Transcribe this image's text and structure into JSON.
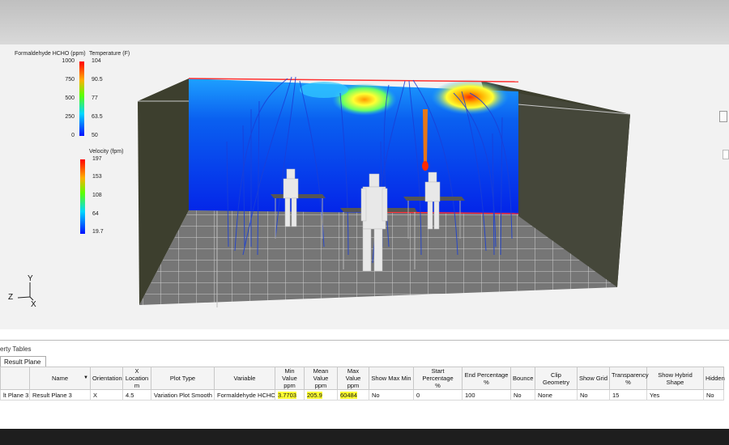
{
  "legends": {
    "hcho": {
      "title": "Formaldehyde HCHO (ppm)",
      "ticks": [
        "1000",
        "750",
        "500",
        "250",
        "0"
      ]
    },
    "temperature": {
      "title": "Temperature (F)",
      "ticks": [
        "104",
        "90.5",
        "77",
        "63.5",
        "50"
      ]
    },
    "velocity": {
      "title": "Velocity (fpm)",
      "ticks": [
        "197",
        "153",
        "108",
        "64",
        "19.7"
      ]
    }
  },
  "axes": {
    "y": "Y",
    "z": "Z",
    "x": "X"
  },
  "property_panel": {
    "title": "erty Tables",
    "tab_label": "Result Plane",
    "columns": [
      {
        "label": ""
      },
      {
        "label": "Name"
      },
      {
        "label": "Orientation"
      },
      {
        "label": "X Location",
        "unit": "m"
      },
      {
        "label": "Plot Type"
      },
      {
        "label": "Variable"
      },
      {
        "label": "Min Value",
        "unit": "ppm"
      },
      {
        "label": "Mean Value",
        "unit": "ppm"
      },
      {
        "label": "Max Value",
        "unit": "ppm"
      },
      {
        "label": "Show Max Min"
      },
      {
        "label": "Start Percentage",
        "unit": "%"
      },
      {
        "label": "End Percentage",
        "unit": "%"
      },
      {
        "label": "Bounce"
      },
      {
        "label": "Clip Geometry"
      },
      {
        "label": "Show Grid"
      },
      {
        "label": "Transparency",
        "unit": "%"
      },
      {
        "label": "Show Hybrid Shape"
      },
      {
        "label": "Hidden"
      }
    ],
    "row": [
      "lt Plane 3",
      "Result Plane 3",
      "X",
      "4.5",
      "Variation Plot Smooth",
      "Formaldehyde HCHO",
      "3.7703",
      "205.9",
      "60484",
      "No",
      "0",
      "100",
      "No",
      "None",
      "No",
      "15",
      "Yes",
      "No"
    ]
  },
  "colors": {
    "highlight": "#ffff33",
    "wall": "#3d3f2e",
    "floor": "#7a7a7a"
  }
}
